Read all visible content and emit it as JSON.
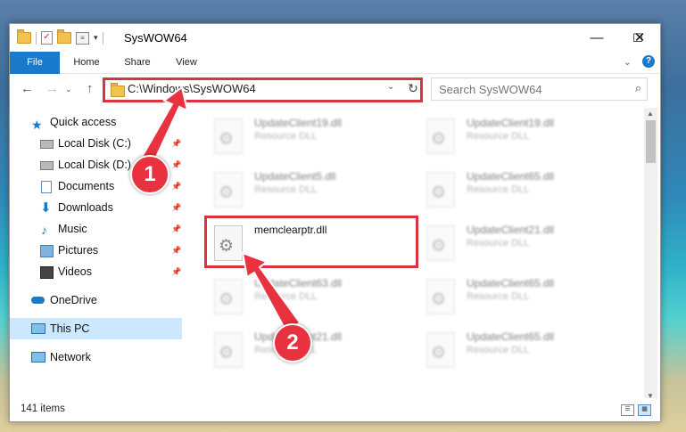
{
  "window": {
    "title": "SysWOW64",
    "buttons": {
      "minimize": "—",
      "maximize": "☐",
      "close": "✕"
    }
  },
  "ribbon": {
    "tabs": [
      "File",
      "Home",
      "Share",
      "View"
    ],
    "help_label": "?"
  },
  "address_bar": {
    "path": "C:\\Windows\\SysWOW64"
  },
  "search": {
    "placeholder": "Search SysWOW64"
  },
  "sidebar": {
    "items": [
      {
        "label": "Quick access",
        "icon": "star-icon",
        "pinned": false
      },
      {
        "label": "Local Disk (C:)",
        "icon": "drive-icon",
        "pinned": true
      },
      {
        "label": "Local Disk (D:)",
        "icon": "drive-icon",
        "pinned": true
      },
      {
        "label": "Documents",
        "icon": "document-icon",
        "pinned": true
      },
      {
        "label": "Downloads",
        "icon": "download-icon",
        "pinned": true
      },
      {
        "label": "Music",
        "icon": "music-icon",
        "pinned": true
      },
      {
        "label": "Pictures",
        "icon": "picture-icon",
        "pinned": true
      },
      {
        "label": "Videos",
        "icon": "video-icon",
        "pinned": true
      },
      {
        "label": "OneDrive",
        "icon": "cloud-icon",
        "pinned": false
      },
      {
        "label": "This PC",
        "icon": "computer-icon",
        "pinned": false,
        "selected": true
      },
      {
        "label": "Network",
        "icon": "network-icon",
        "pinned": false
      }
    ]
  },
  "files": [
    {
      "name": "UpdateClient19.dll",
      "type": "Resource DLL",
      "blurred": true
    },
    {
      "name": "UpdateClient19.dll",
      "type": "Resource DLL",
      "blurred": true
    },
    {
      "name": "UpdateClient5.dll",
      "type": "Resource DLL",
      "blurred": true
    },
    {
      "name": "UpdateClient65.dll",
      "type": "Resource DLL",
      "blurred": true
    },
    {
      "name": "memclearptr.dll",
      "type": "",
      "blurred": false
    },
    {
      "name": "UpdateClient21.dll",
      "type": "Resource DLL",
      "blurred": true
    },
    {
      "name": "UpdateClient63.dll",
      "type": "Resource DLL",
      "blurred": true
    },
    {
      "name": "UpdateClient65.dll",
      "type": "Resource DLL",
      "blurred": true
    },
    {
      "name": "UpdateClient21.dll",
      "type": "Resource DLL",
      "blurred": true
    },
    {
      "name": "UpdateClient65.dll",
      "type": "Resource DLL",
      "blurred": true
    }
  ],
  "status": {
    "item_count": "141 items"
  },
  "callouts": [
    "1",
    "2"
  ],
  "colors": {
    "accent": "#1979ca",
    "highlight": "#d9333f",
    "selected_nav": "#cce8ff"
  }
}
